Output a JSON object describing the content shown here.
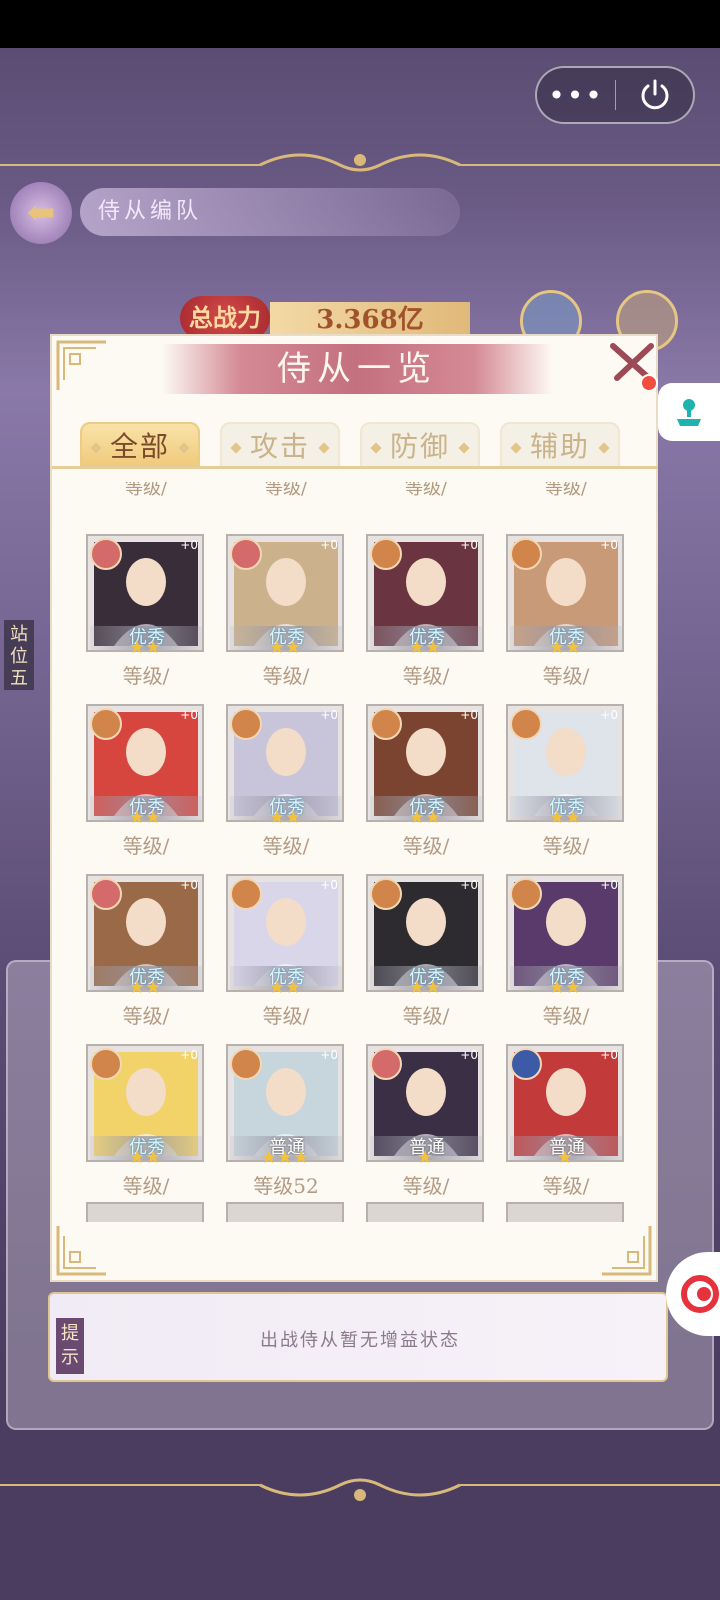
{
  "capsule": {
    "more_label": "•••",
    "power_icon": "power-icon"
  },
  "background": {
    "header_title": "侍从编队",
    "power_label": "总战力",
    "power_value": "3.368亿",
    "side_label": "站位五",
    "tip_badge": "提示",
    "tip_text": "出战侍从暂无增益状态"
  },
  "modal": {
    "title": "侍从一览",
    "tabs": [
      {
        "label": "全部",
        "active": true
      },
      {
        "label": "攻击",
        "active": false
      },
      {
        "label": "防御",
        "active": false
      },
      {
        "label": "辅助",
        "active": false
      }
    ],
    "partial_level_text": "等级/",
    "cards": [
      {
        "badge": "heart",
        "plus": "+0",
        "grade": "优秀",
        "grade_type": "excellent",
        "stars": "★★",
        "level": "等级/",
        "art": "#3a2d3a"
      },
      {
        "badge": "heart",
        "plus": "+0",
        "grade": "优秀",
        "grade_type": "excellent",
        "stars": "★★",
        "level": "等级/",
        "art": "#cbb28c"
      },
      {
        "badge": "attack",
        "plus": "+0",
        "grade": "优秀",
        "grade_type": "excellent",
        "stars": "★★",
        "level": "等级/",
        "art": "#6a3540"
      },
      {
        "badge": "attack",
        "plus": "+0",
        "grade": "优秀",
        "grade_type": "excellent",
        "stars": "★★",
        "level": "等级/",
        "art": "#c99a78"
      },
      {
        "badge": "attack",
        "plus": "+0",
        "grade": "优秀",
        "grade_type": "excellent",
        "stars": "★★",
        "level": "等级/",
        "art": "#d7453f"
      },
      {
        "badge": "attack",
        "plus": "+0",
        "grade": "优秀",
        "grade_type": "excellent",
        "stars": "★★",
        "level": "等级/",
        "art": "#c8c4d9"
      },
      {
        "badge": "attack",
        "plus": "+0",
        "grade": "优秀",
        "grade_type": "excellent",
        "stars": "★★",
        "level": "等级/",
        "art": "#7a4430"
      },
      {
        "badge": "attack",
        "plus": "+0",
        "grade": "优秀",
        "grade_type": "excellent",
        "stars": "★★",
        "level": "等级/",
        "art": "#dfe3ea"
      },
      {
        "badge": "heart",
        "plus": "+0",
        "grade": "优秀",
        "grade_type": "excellent",
        "stars": "★★",
        "level": "等级/",
        "art": "#9a6a48"
      },
      {
        "badge": "attack",
        "plus": "+0",
        "grade": "优秀",
        "grade_type": "excellent",
        "stars": "★★",
        "level": "等级/",
        "art": "#d9d6ea"
      },
      {
        "badge": "attack",
        "plus": "+0",
        "grade": "优秀",
        "grade_type": "excellent",
        "stars": "★★",
        "level": "等级/",
        "art": "#2d2a30"
      },
      {
        "badge": "attack",
        "plus": "+0",
        "grade": "优秀",
        "grade_type": "excellent",
        "stars": "★★",
        "level": "等级/",
        "art": "#5a3a6a"
      },
      {
        "badge": "attack",
        "plus": "+0",
        "grade": "优秀",
        "grade_type": "excellent",
        "stars": "★★",
        "level": "等级/",
        "art": "#f2d36a"
      },
      {
        "badge": "attack",
        "plus": "+0",
        "grade": "普通",
        "grade_type": "normal",
        "stars": "★★★",
        "level": "等级52",
        "art": "#c7d6dc"
      },
      {
        "badge": "heart",
        "plus": "+0",
        "grade": "普通",
        "grade_type": "normal",
        "stars": "★",
        "level": "等级/",
        "art": "#3a2f44"
      },
      {
        "badge": "shield",
        "plus": "+0",
        "grade": "普通",
        "grade_type": "normal",
        "stars": "★",
        "level": "等级/",
        "art": "#c23a3a"
      }
    ]
  },
  "colors": {
    "accent": "#c4707f",
    "gold": "#e6c684",
    "star": "#f3c23b",
    "close_dot": "#f24d3d"
  }
}
